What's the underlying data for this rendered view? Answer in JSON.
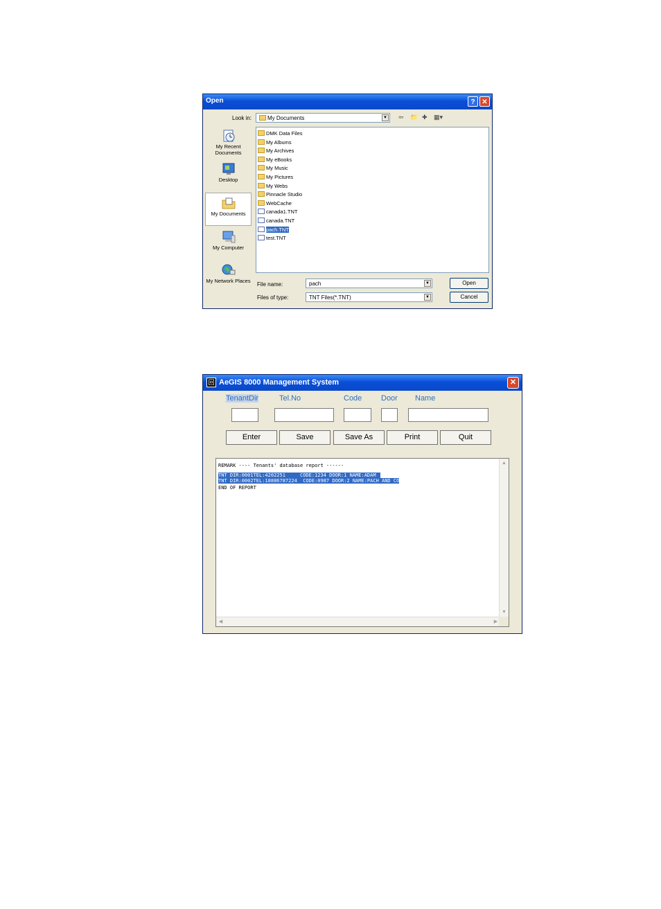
{
  "open_dialog": {
    "title": "Open",
    "help_glyph": "?",
    "close_glyph": "✕",
    "look_in_label": "Look in:",
    "look_in_value": "My Documents",
    "toolbar_icons": [
      "back-icon",
      "up-folder-icon",
      "new-folder-icon",
      "views-menu-icon"
    ],
    "places": [
      {
        "label": "My Recent Documents",
        "icon": "recent-documents-icon"
      },
      {
        "label": "Desktop",
        "icon": "desktop-icon"
      },
      {
        "label": "My Documents",
        "icon": "my-documents-icon"
      },
      {
        "label": "My Computer",
        "icon": "my-computer-icon"
      },
      {
        "label": "My Network Places",
        "icon": "network-places-icon"
      }
    ],
    "files": [
      {
        "name": "DMK Data Files",
        "kind": "folder"
      },
      {
        "name": "My Albums",
        "kind": "folder"
      },
      {
        "name": "My Archives",
        "kind": "folder"
      },
      {
        "name": "My eBooks",
        "kind": "folder"
      },
      {
        "name": "My Music",
        "kind": "folder"
      },
      {
        "name": "My Pictures",
        "kind": "folder"
      },
      {
        "name": "My Webs",
        "kind": "folder"
      },
      {
        "name": "Pinnacle Studio",
        "kind": "folder"
      },
      {
        "name": "WebCache",
        "kind": "folder"
      },
      {
        "name": "canada1.TNT",
        "kind": "file"
      },
      {
        "name": "canada.TNT",
        "kind": "file"
      },
      {
        "name": "pach.TNT",
        "kind": "file"
      },
      {
        "name": "test.TNT",
        "kind": "file"
      }
    ],
    "file_name_label": "File name:",
    "file_name_value": "pach",
    "files_of_type_label": "Files of type:",
    "files_of_type_value": "TNT Files(*.TNT)",
    "open_button": "Open",
    "cancel_button": "Cancel"
  },
  "aegis": {
    "title": "AeGIS 8000 Management System",
    "app_icon_glyph": "回",
    "close_glyph": "✕",
    "fields": [
      {
        "label": "TenantDir",
        "value": ""
      },
      {
        "label": "Tel.No",
        "value": ""
      },
      {
        "label": "Code",
        "value": ""
      },
      {
        "label": "Door",
        "value": ""
      },
      {
        "label": "Name",
        "value": ""
      }
    ],
    "buttons": [
      "Enter",
      "Save",
      "Save As",
      "Print",
      "Quit"
    ],
    "report_lines": [
      "REMARK ---- Tenants' database report ------",
      "TNT DIR:0001TEL:4202251     CODE:1234 DOOR:1 NAME:ADAM",
      "TNT DIR:0002TEL:18886787224  CODE:0987 DOOR:2 NAME:PACH AND CO",
      "END OF REPORT"
    ]
  }
}
